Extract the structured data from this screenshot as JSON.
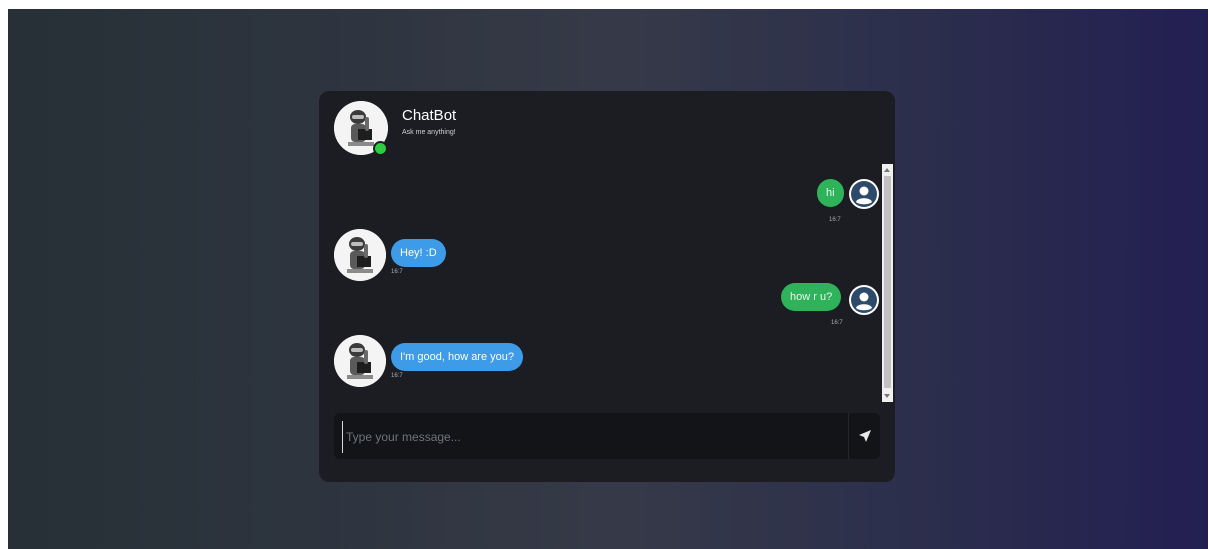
{
  "header": {
    "bot_name": "ChatBot",
    "bot_status": "Ask me anything!",
    "online": true
  },
  "messages": [
    {
      "sender": "user",
      "text": "hi",
      "time": "16:7"
    },
    {
      "sender": "bot",
      "text": "Hey! :D",
      "time": "16:7"
    },
    {
      "sender": "user",
      "text": "how r u?",
      "time": "16:7"
    },
    {
      "sender": "bot",
      "text": "I'm good, how are you?",
      "time": "16:7"
    }
  ],
  "composer": {
    "placeholder": "Type your message...",
    "value": ""
  },
  "icons": {
    "send": "send-arrow-icon",
    "user_avatar": "user-silhouette-icon",
    "bot_avatar": "robot-icon"
  },
  "colors": {
    "user_bubble": "#2fb35a",
    "bot_bubble": "#3d9be8",
    "online": "#2ecc40",
    "card": "#1b1d22"
  }
}
